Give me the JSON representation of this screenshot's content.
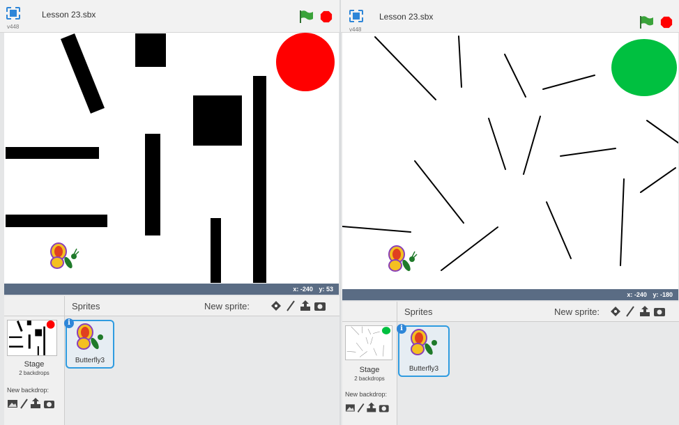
{
  "left": {
    "title": "Lesson 23.sbx",
    "version": "v448",
    "coords": {
      "x_label": "x:",
      "x": "-240",
      "y_label": "y:",
      "y": "53"
    },
    "sprites_label": "Sprites",
    "new_sprite_label": "New sprite:",
    "stage_label": "Stage",
    "stage_sub": "2 backdrops",
    "new_backdrop_label": "New backdrop:",
    "sprite_name": "Butterfly3",
    "stop_color": "#ff0000",
    "circle_color": "#ff0000"
  },
  "right": {
    "title": "Lesson 23.sbx",
    "version": "v448",
    "coords": {
      "x_label": "x:",
      "x": "-240",
      "y_label": "y:",
      "y": "-180"
    },
    "sprites_label": "Sprites",
    "new_sprite_label": "New sprite:",
    "stage_label": "Stage",
    "stage_sub": "2 backdrops",
    "new_backdrop_label": "New backdrop:",
    "sprite_name": "Butterfly3",
    "stop_color": "#ff0000",
    "circle_color": "#00c040"
  },
  "icons": {
    "fullscreen": "fullscreen-icon",
    "green_flag": "green-flag-icon",
    "stop": "stop-sign-icon",
    "paint": "paint-new-sprite-icon",
    "library": "sprite-library-icon",
    "upload": "upload-icon",
    "camera": "camera-icon",
    "info": "info-icon"
  },
  "info_glyph": "i"
}
